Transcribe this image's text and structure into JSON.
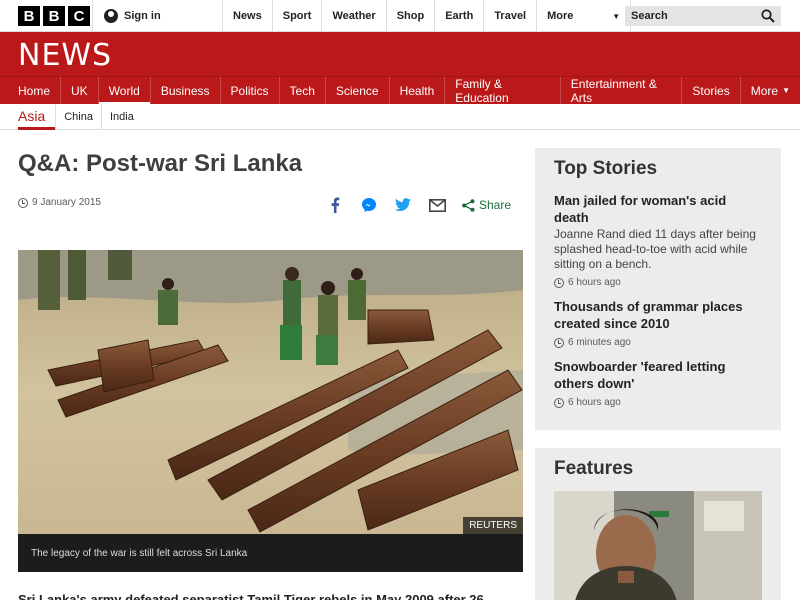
{
  "brand": {
    "logo_letters": [
      "B",
      "B",
      "C"
    ],
    "section": "NEWS"
  },
  "topbar": {
    "signin_label": "Sign in",
    "nav": [
      "News",
      "Sport",
      "Weather",
      "Shop",
      "Earth",
      "Travel"
    ],
    "more_label": "More",
    "search_placeholder": "Search"
  },
  "rednav": {
    "items": [
      "Home",
      "UK",
      "World",
      "Business",
      "Politics",
      "Tech",
      "Science",
      "Health",
      "Family & Education",
      "Entertainment & Arts",
      "Stories"
    ],
    "active": "World",
    "more_label": "More"
  },
  "subnav": {
    "current": "Asia",
    "items": [
      "China",
      "India"
    ]
  },
  "article": {
    "headline": "Q&A: Post-war Sri Lanka",
    "date": "9 January 2015",
    "share_label": "Share",
    "image_credit": "REUTERS",
    "image_caption": "The legacy of the war is still felt across Sri Lanka",
    "body_start": "Sri Lanka's army defeated separatist Tamil Tiger rebels in May 2009 after 26"
  },
  "top_stories": {
    "title": "Top Stories",
    "stories": [
      {
        "headline": "Man jailed for woman's acid death",
        "summary": "Joanne Rand died 11 days after being splashed head-to-toe with acid while sitting on a bench.",
        "time": "6 hours ago"
      },
      {
        "headline": "Thousands of grammar places created since 2010",
        "summary": "",
        "time": "6 minutes ago"
      },
      {
        "headline": "Snowboarder 'feared letting others down'",
        "summary": "",
        "time": "6 hours ago"
      }
    ]
  },
  "features": {
    "title": "Features"
  },
  "colors": {
    "brand_red": "#bb1919",
    "share_green": "#1a6e3d",
    "sidebar_bg": "#ececec"
  },
  "icons": [
    "user-icon",
    "search-icon",
    "clock-icon",
    "facebook-icon",
    "messenger-icon",
    "twitter-icon",
    "email-icon",
    "share-icon"
  ]
}
